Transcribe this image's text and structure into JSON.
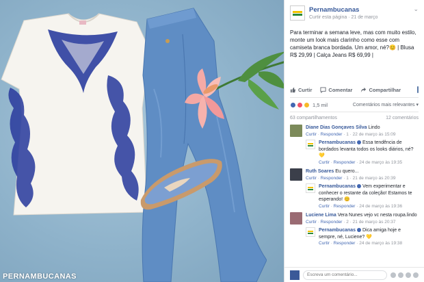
{
  "photo": {
    "watermark": "PERNAMBUCANAS"
  },
  "post": {
    "page_name": "Pernambucanas",
    "follow_label": "Curtir esta página",
    "date": "21 de março",
    "caption": "Para terminar a semana leve, mas com muito estilo, monte um look mais clarinho como esse com camiseta branca bordada. Um amor, né?😊 | Blusa R$ 29,99 | Calça Jeans R$ 69,99 |"
  },
  "actions": {
    "like": "Curtir",
    "comment": "Comentar",
    "share": "Compartilhar"
  },
  "reactions": {
    "count": "1,5 mil",
    "sort": "Comentários mais relevantes ▾"
  },
  "stats": {
    "shares": "63 compartilhamentos",
    "comments": "12 comentários"
  },
  "comments": [
    {
      "author": "Diane Dias Gonçaves Silva",
      "text": "Lindo",
      "like": "Curtir",
      "reply": "Responder",
      "meta": "1 · 22 de março às 15:09",
      "reply_author": "Pernambucanas",
      "reply_text": "Essa tendência de bordados levanta todos os looks diários, né? 💛",
      "reply_meta": "24 de março às 19:35"
    },
    {
      "author": "Ruth Soares",
      "text": "Eu quero...",
      "like": "Curtir",
      "reply": "Responder",
      "meta": "1 · 21 de março às 20:39",
      "reply_author": "Pernambucanas",
      "reply_text": "Vem experimentar e conhecer o restante da coleção! Estamos te esperando! 😊",
      "reply_meta": "24 de março às 19:36"
    },
    {
      "author": "Luciene Lima",
      "text": "Vera Nunes vejo vc nesta roupa.lindo",
      "like": "Curtir",
      "reply": "Responder",
      "meta": "2 · 21 de março às 20:37",
      "reply_author": "Pernambucanas",
      "reply_text": "Dica amiga hoje e sempre, né, Luciene? 💛",
      "reply_meta": "24 de março às 19:38"
    }
  ],
  "composer": {
    "placeholder": "Escreva um comentário..."
  },
  "colors": {
    "link": "#365899",
    "brand_yellow": "#f2c300",
    "brand_green": "#2c8a3c"
  }
}
